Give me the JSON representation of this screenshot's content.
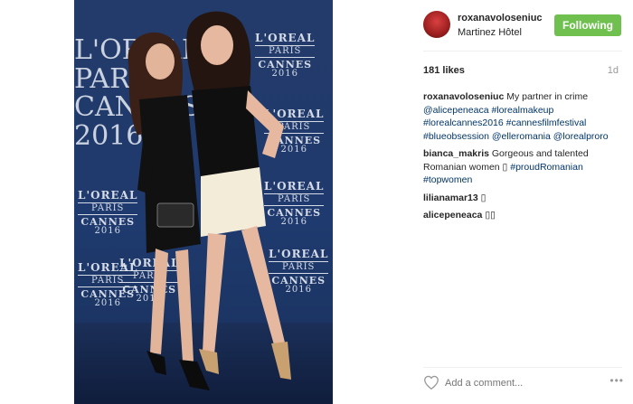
{
  "post": {
    "username": "roxanavoloseniuc",
    "location": "Martinez Hôtel",
    "follow_label": "Following",
    "likes": "181 likes",
    "time": "1d"
  },
  "photo": {
    "logo_lines": [
      "L'OREAL",
      "PARIS",
      "CANNES",
      "2016"
    ],
    "big_logo": [
      "L'ORÉAL",
      "PARIS",
      "CANNES",
      "2016"
    ]
  },
  "comments": [
    {
      "user": "roxanavoloseniuc",
      "text": "My partner in crime",
      "tags": "@alicepeneaca #lorealmakeup #lorealcannes2016 #cannesfilmfestival #blueobsession @elleromania @lorealproro"
    },
    {
      "user": "bianca_makris",
      "text": "Gorgeous and talented Romanian women ▯",
      "tags": "#proudRomanian #topwomen"
    },
    {
      "user": "lilianamar13",
      "text": "▯",
      "tags": ""
    },
    {
      "user": "alicepeneaca",
      "text": "▯▯",
      "tags": ""
    }
  ],
  "footer": {
    "comment_placeholder": "Add a comment...",
    "more": "•••"
  },
  "colors": {
    "follow_green": "#70c050",
    "link_blue": "#003569",
    "background_blue": "#1f3a6e"
  }
}
